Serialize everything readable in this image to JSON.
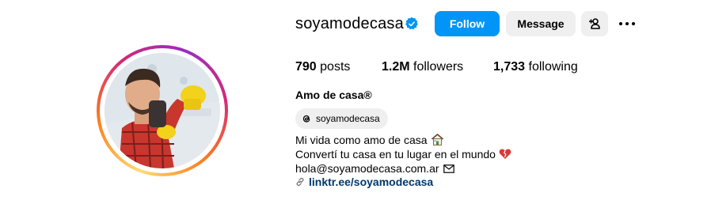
{
  "profile": {
    "username": "soyamodecasa",
    "verified_icon": "verified-badge-icon",
    "full_name": "Amo de casa®",
    "avatar_icon": "profile-photo"
  },
  "actions": {
    "follow_label": "Follow",
    "message_label": "Message",
    "suggest_icon": "add-person-icon",
    "more_icon": "more-options-icon"
  },
  "stats": [
    {
      "value": "790",
      "label": "posts"
    },
    {
      "value": "1.2M",
      "label": "followers"
    },
    {
      "value": "1,733",
      "label": "following"
    }
  ],
  "threads": {
    "handle": "soyamodecasa",
    "icon": "threads-icon"
  },
  "bio": {
    "line1": "Mi vida como amo de casa",
    "line1_icon": "house-emoji",
    "line2": "Convertí tu casa en tu lugar en el mundo",
    "line2_icon": "broken-heart-emoji",
    "line3": "hola@soyamodecasa.com.ar",
    "line3_icon": "envelope-icon"
  },
  "link": {
    "text": "linktr.ee/soyamodecasa",
    "icon": "link-icon"
  },
  "colors": {
    "primary_blue": "#0095f6",
    "link_blue": "#00376b",
    "button_grey": "#efefef"
  }
}
